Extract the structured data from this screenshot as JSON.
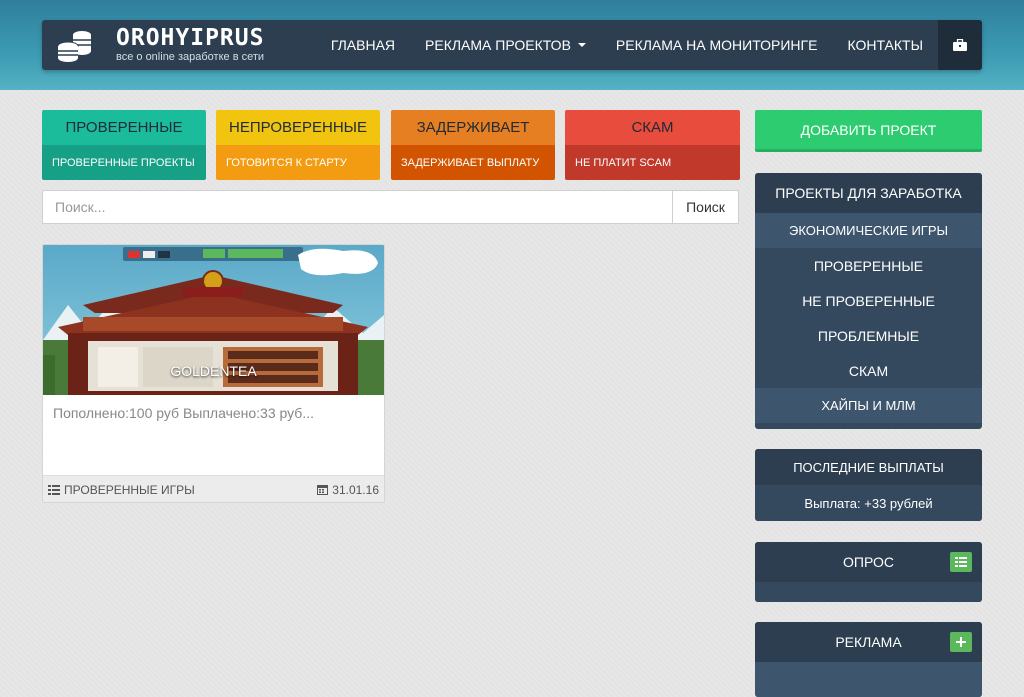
{
  "brand": {
    "title": "OROHYIPRUS",
    "subtitle": "все о online заработке в сети"
  },
  "nav": {
    "home": "ГЛАВНАЯ",
    "ads_projects": "РЕКЛАМА ПРОЕКТОВ",
    "ads_monitoring": "РЕКЛАМА НА МОНИТОРИНГЕ",
    "contacts": "КОНТАКТЫ"
  },
  "status_boxes": [
    {
      "title": "ПРОВЕРЕННЫЕ",
      "subtitle": "ПРОВЕРЕННЫЕ ПРОЕКТЫ",
      "color": "#1abc9c"
    },
    {
      "title": "НЕПРОВЕРЕННЫЕ",
      "subtitle": "ГОТОВИТСЯ К СТАРТУ",
      "color": "#f1c40f"
    },
    {
      "title": "ЗАДЕРЖИВАЕТ",
      "subtitle": "ЗАДЕРЖИВАЕТ ВЫПЛАТУ",
      "color": "#e67e22"
    },
    {
      "title": "СКАМ",
      "subtitle": "НЕ ПЛАТИТ SCAM",
      "color": "#e74c3c"
    }
  ],
  "search": {
    "placeholder": "Поиск...",
    "button": "Поиск"
  },
  "card": {
    "title": "GOLDENTEA",
    "image_brand": "GOLDEN-TEA",
    "description": "Пополнено:100 руб Выплачено:33 руб...",
    "category": "ПРОВЕРЕННЫЕ ИГРЫ",
    "date": "31.01.16"
  },
  "sidebar": {
    "add_project": "ДОБАВИТЬ ПРОЕКТ",
    "projects_panel": {
      "title": "ПРОЕКТЫ ДЛЯ ЗАРАБОТКА",
      "items": [
        "ЭКОНОМИЧЕСКИЕ ИГРЫ",
        "ПРОВЕРЕННЫЕ",
        "НЕ ПРОВЕРЕННЫЕ",
        "ПРОБЛЕМНЫЕ",
        "СКАМ",
        "ХАЙПЫ И МЛМ"
      ]
    },
    "payouts_panel": {
      "title": "ПОСЛЕДНИЕ ВЫПЛАТЫ",
      "item": "Выплата: +33 рублей"
    },
    "poll_panel": {
      "title": "ОПРОС"
    },
    "ads_panel": {
      "title": "РЕКЛАМА"
    }
  },
  "colors": {
    "navbar": "#2c3e50",
    "sidebar_panel": "#34495e",
    "add_button": "#2ecc71",
    "icon_green": "#5cb85c"
  }
}
